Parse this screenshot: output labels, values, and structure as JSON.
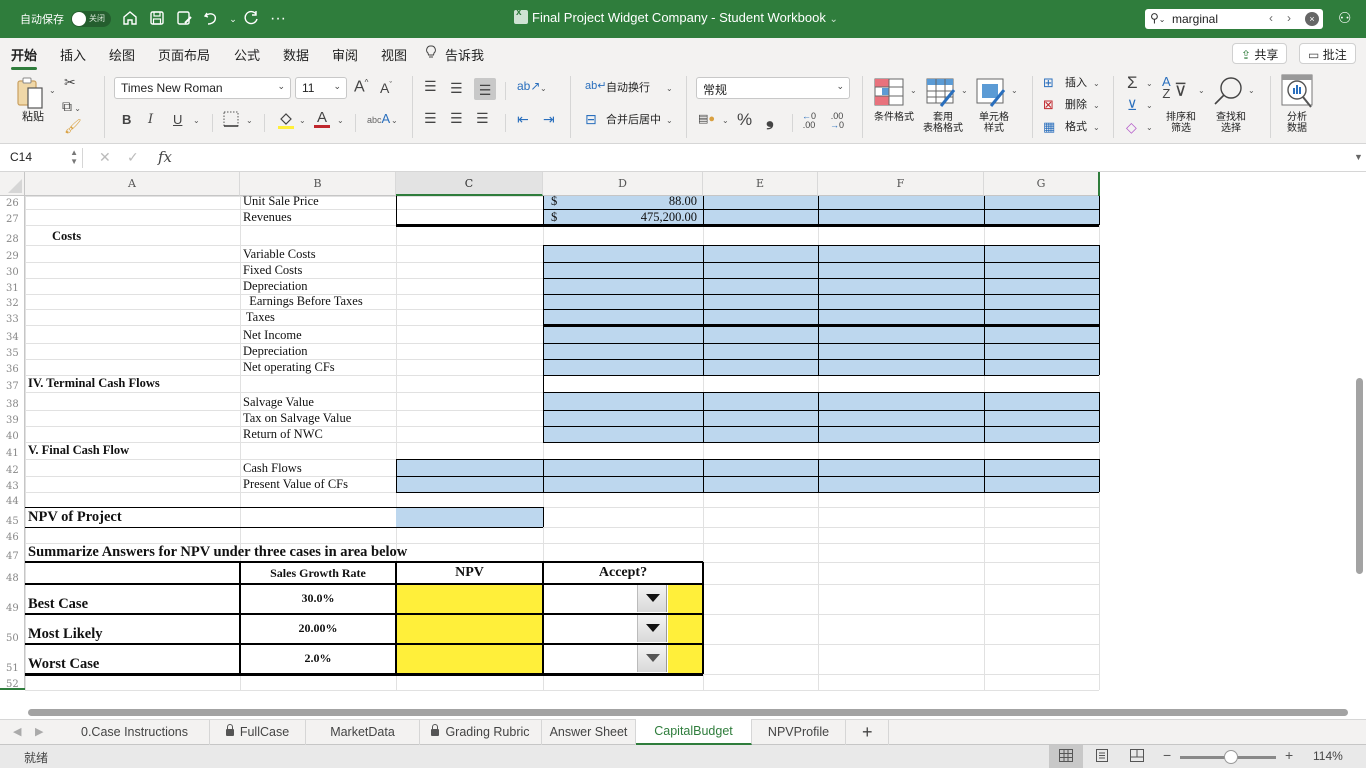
{
  "titlebar": {
    "autosave_label": "自动保存",
    "autosave_state": "关闭",
    "doc_title": "Final Project Widget Company - Student Workbook",
    "title_chevron": "⌄",
    "search_value": "marginal",
    "icons": [
      "home-icon",
      "save-icon",
      "save-as-icon",
      "undo-icon",
      "redo-icon",
      "more-icon",
      "share-people-icon"
    ]
  },
  "ribbon_tabs": {
    "tabs": [
      {
        "label": "开始",
        "active": true
      },
      {
        "label": "插入"
      },
      {
        "label": "绘图"
      },
      {
        "label": "页面布局"
      },
      {
        "label": "公式"
      },
      {
        "label": "数据"
      },
      {
        "label": "审阅"
      },
      {
        "label": "视图"
      },
      {
        "label": "告诉我"
      }
    ],
    "share_label": "共享",
    "comments_label": "批注"
  },
  "ribbon": {
    "paste_label": "粘贴",
    "font_name": "Times New Roman",
    "font_size": "11",
    "wrap_text_label": "自动换行",
    "merge_center_label": "合并后居中",
    "number_format": "常规",
    "conditional_format_label": "条件格式",
    "format_as_table_label_1": "套用",
    "format_as_table_label_2": "表格格式",
    "cell_styles_label_1": "单元格",
    "cell_styles_label_2": "样式",
    "insert_label": "插入",
    "delete_label": "删除",
    "format_label": "格式",
    "sort_filter_label_1": "排序和",
    "sort_filter_label_2": "筛选",
    "find_select_label_1": "查找和",
    "find_select_label_2": "选择",
    "analyze_label_1": "分析",
    "analyze_label_2": "数据",
    "bold": "B",
    "italic": "I",
    "underline": "U",
    "percent": "%",
    "comma": "❟",
    "increase_font": "A",
    "decrease_font": "A",
    "font_color": "A",
    "fill_color": "#ffef3a",
    "font_color_bar": "#c0272d"
  },
  "formula_bar": {
    "name_box": "C14",
    "fx": "fx",
    "content": ""
  },
  "grid": {
    "columns": [
      "A",
      "B",
      "C",
      "D",
      "E",
      "F",
      "G"
    ],
    "selected_column": "C",
    "rows": [
      {
        "num": "26",
        "b": "Unit Sale Price",
        "d_currency": "$",
        "d_value": "88.00"
      },
      {
        "num": "27",
        "b": "Revenues",
        "d_currency": "$",
        "d_value": "475,200.00"
      },
      {
        "num": "28",
        "a": "Costs"
      },
      {
        "num": "29",
        "b": "Variable Costs"
      },
      {
        "num": "30",
        "b": "Fixed Costs"
      },
      {
        "num": "31",
        "b": "Depreciation"
      },
      {
        "num": "32",
        "b": "  Earnings Before Taxes"
      },
      {
        "num": "33",
        "b": " Taxes"
      },
      {
        "num": "34",
        "b": "Net Income"
      },
      {
        "num": "35",
        "b": "Depreciation"
      },
      {
        "num": "36",
        "b": "Net operating CFs"
      },
      {
        "num": "37",
        "a": "IV. Terminal Cash Flows"
      },
      {
        "num": "38",
        "b": "Salvage Value"
      },
      {
        "num": "39",
        "b": "Tax on Salvage Value"
      },
      {
        "num": "40",
        "b": "Return of NWC"
      },
      {
        "num": "41",
        "a": "V. Final Cash Flow"
      },
      {
        "num": "42",
        "b": "Cash Flows"
      },
      {
        "num": "43",
        "b": "Present Value of CFs"
      },
      {
        "num": "44"
      },
      {
        "num": "45",
        "a": "NPV of Project"
      },
      {
        "num": "46"
      },
      {
        "num": "47",
        "a": "Summarize Answers for NPV under three cases in area below"
      },
      {
        "num": "48"
      },
      {
        "num": "49",
        "a": "Best Case"
      },
      {
        "num": "50",
        "a": "Most Likely"
      },
      {
        "num": "51",
        "a": "Worst Case"
      },
      {
        "num": "52"
      }
    ],
    "summary_table": {
      "headers": [
        "",
        "Sales Growth Rate",
        "NPV",
        "Accept?"
      ],
      "rows": [
        {
          "case": "Best Case",
          "growth": "30.0%",
          "npv": "",
          "accept": ""
        },
        {
          "case": "Most Likely",
          "growth": "20.00%",
          "npv": "",
          "accept": ""
        },
        {
          "case": "Worst Case",
          "growth": "2.0%",
          "npv": "",
          "accept": ""
        }
      ]
    },
    "colors": {
      "input_fill": "#bdd7ee",
      "answer_fill": "#ffef3a"
    }
  },
  "sheet_tabs": {
    "tabs": [
      {
        "label": "0.Case Instructions",
        "locked": false
      },
      {
        "label": "FullCase",
        "locked": true
      },
      {
        "label": "MarketData",
        "locked": false
      },
      {
        "label": "Grading Rubric",
        "locked": true
      },
      {
        "label": "Answer Sheet",
        "locked": false
      },
      {
        "label": "CapitalBudget",
        "locked": false,
        "active": true
      },
      {
        "label": "NPVProfile",
        "locked": false
      }
    ],
    "add_label": "+"
  },
  "status_bar": {
    "ready": "就绪",
    "zoom": "114%",
    "zoom_minus": "−",
    "zoom_plus": "+"
  },
  "theme": {
    "accent": "#2f7d3c"
  }
}
